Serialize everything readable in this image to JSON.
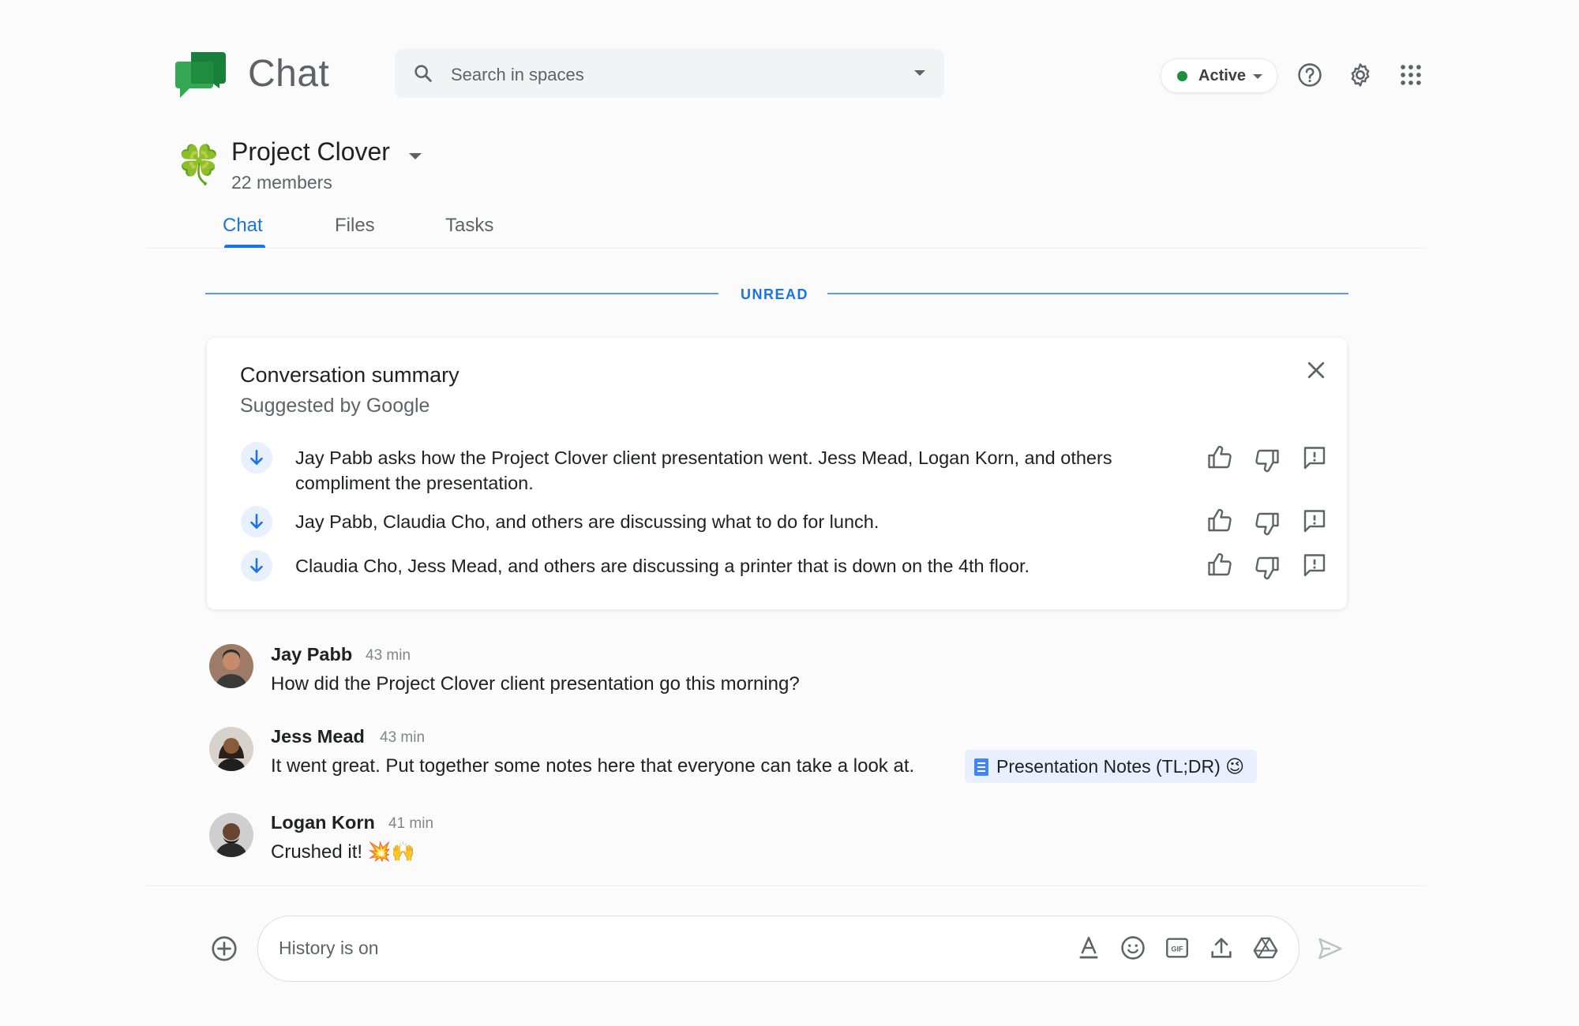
{
  "app": {
    "title": "Chat"
  },
  "search": {
    "placeholder": "Search in spaces"
  },
  "status": {
    "label": "Active",
    "color": "#1e8e3e"
  },
  "header_icons": [
    "help-icon",
    "settings-icon",
    "apps-grid-icon"
  ],
  "space": {
    "name": "Project Clover",
    "members": "22 members",
    "emoji": "🍀"
  },
  "tabs": [
    {
      "label": "Chat",
      "active": true
    },
    {
      "label": "Files",
      "active": false
    },
    {
      "label": "Tasks",
      "active": false
    }
  ],
  "unread_label": "UNREAD",
  "summary": {
    "title": "Conversation summary",
    "subtitle": "Suggested by Google",
    "items": [
      {
        "text": "Jay Pabb asks how the Project Clover client presentation went. Jess Mead, Logan Korn, and others compliment the presentation."
      },
      {
        "text": "Jay Pabb, Claudia Cho, and others are discussing what to do for lunch."
      },
      {
        "text": "Claudia Cho, Jess Mead, and others are discussing a printer that is down on the 4th floor."
      }
    ]
  },
  "messages": [
    {
      "name": "Jay Pabb",
      "time": "43 min",
      "text": "How did the Project Clover client presentation go this morning?"
    },
    {
      "name": "Jess Mead",
      "time": "43 min",
      "text": "It went great. Put together some notes here that everyone can take a look at.",
      "attachment": {
        "label": "Presentation Notes (TL;DR)",
        "emoji": "😉"
      }
    },
    {
      "name": "Logan Korn",
      "time": "41 min",
      "text": "Crushed it!",
      "emoji": "💥🙌"
    }
  ],
  "composer": {
    "placeholder": "History is on"
  },
  "colors": {
    "accent": "#1a73e8",
    "chat_green": "#34a853"
  }
}
